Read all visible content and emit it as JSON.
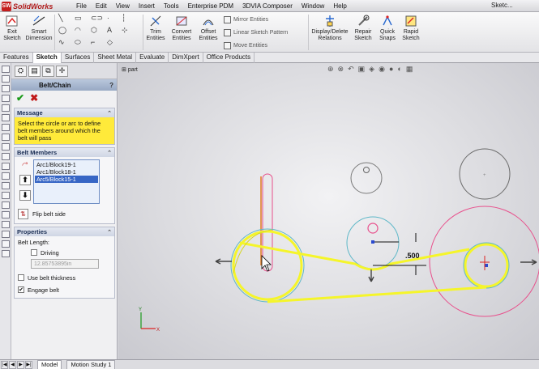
{
  "app": {
    "logo_text": "SolidWorks",
    "window_title": "Sketc..."
  },
  "menu": [
    "File",
    "Edit",
    "View",
    "Insert",
    "Tools",
    "Enterprise PDM",
    "3DVIA Composer",
    "Window",
    "Help"
  ],
  "toolbar": {
    "exit_sketch": "Exit Sketch",
    "smart_dimension": "Smart Dimension",
    "trim_entities": "Trim Entities",
    "convert_entities": "Convert Entities",
    "offset_entities": "Offset Entities",
    "mirror_entities": "Mirror Entities",
    "linear_sketch_pattern": "Linear Sketch Pattern",
    "move_entities": "Move Entities",
    "display_delete_relations": "Display/Delete Relations",
    "repair_sketch": "Repair Sketch",
    "quick_snaps": "Quick Snaps",
    "rapid_sketch": "Rapid Sketch"
  },
  "tabs": [
    "Features",
    "Sketch",
    "Surfaces",
    "Sheet Metal",
    "Evaluate",
    "DimXpert",
    "Office Products"
  ],
  "active_tab": "Sketch",
  "property_manager": {
    "title": "Belt/Chain",
    "help": "?",
    "message_header": "Message",
    "message": "Select the circle or arc to define belt members around which the belt will pass",
    "belt_members_header": "Belt Members",
    "members": [
      "Arc1/Block19-1",
      "Arc1/Block18-1",
      "Arc5/Block15-1"
    ],
    "selected_member_index": 2,
    "flip_belt_side": "Flip belt side",
    "properties_header": "Properties",
    "belt_length_label": "Belt Length:",
    "driving_label": "Driving",
    "driving_checked": false,
    "belt_length_value": "12.85753895in",
    "use_belt_thickness_label": "Use belt thickness",
    "use_belt_thickness_checked": false,
    "engage_belt_label": "Engage belt",
    "engage_belt_checked": true
  },
  "graphics": {
    "tree_label": "part",
    "dimension_value": ".500",
    "belt_color": "#f5f52a",
    "circle_color": "#5fb8c8",
    "construction_color": "#e8508c"
  },
  "bottom_tabs": [
    "Model",
    "Motion Study 1"
  ],
  "active_bottom_tab": "Model"
}
